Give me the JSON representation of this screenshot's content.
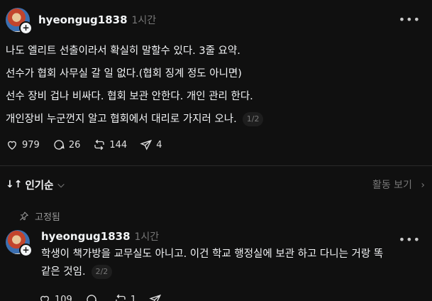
{
  "post": {
    "username": "hyeongug1838",
    "time": "1시간",
    "lines": [
      "나도 엘리트 선출이라서 확실히 말할수 있다. 3줄 요약.",
      "선수가 협회 사무실 갈 일 없다.(협회 징계 정도 아니면)",
      "선수 장비 겁나 비싸다. 협회 보관 안한다. 개인 관리 한다.",
      "개인장비 누군껀지 알고 협회에서 대리로 가지러 오나."
    ],
    "pager": "1/2",
    "likes": "979",
    "comments": "26",
    "reposts": "144",
    "shares": "4"
  },
  "sort": {
    "label": "인기순",
    "activity_label": "활동 보기"
  },
  "reply": {
    "pinned_label": "고정됨",
    "username": "hyeongug1838",
    "time": "1시간",
    "lines": [
      "학생이 책가방을 교무실도 아니고. 이건 학교 행정실에 보관 하고 다니는 거랑 똑",
      "같은 것임."
    ],
    "pager": "2/2",
    "likes": "109",
    "comments": "",
    "reposts": "1"
  },
  "colors": {
    "background": "#101010",
    "text": "#f3f5f7",
    "muted": "#777777"
  }
}
